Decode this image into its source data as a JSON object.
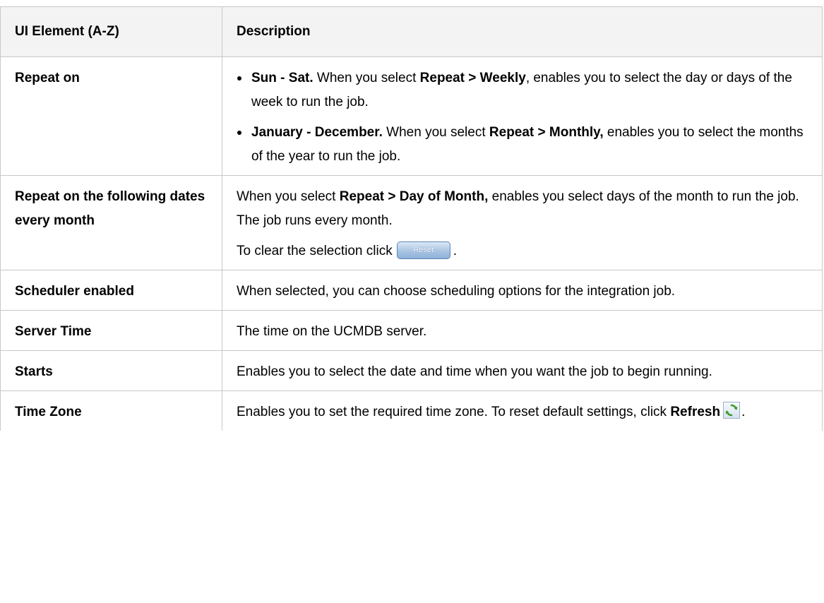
{
  "table": {
    "header": {
      "col1": "UI Element (A-Z)",
      "col2": "Description"
    },
    "rows": [
      {
        "term": "Repeat on",
        "bullets": [
          {
            "bold": "Sun - Sat.",
            "t1": " When you select ",
            "b2": "Repeat > Weekly",
            "t2": ", enables you to select the day or days of the week to run the job."
          },
          {
            "bold": "January - December.",
            "t1": " When you select ",
            "b2": "Repeat > Monthly,",
            "t2": " enables you to select the months of the year to run the job."
          }
        ]
      },
      {
        "term": "Repeat on the following dates every month",
        "p1_t1": "When you select ",
        "p1_b1": "Repeat > Day of Month,",
        "p1_t2": " enables you select days of the month to run the job. The job runs every month.",
        "p2_t1": "To clear the selection click",
        "reset_label": "Reset",
        "p2_t2": "."
      },
      {
        "term": "Scheduler enabled",
        "desc": "When selected, you can choose scheduling options for the integration job."
      },
      {
        "term": "Server Time",
        "desc": "The time on the UCMDB server."
      },
      {
        "term": "Starts",
        "desc": "Enables you to select the date and time when you want the job to begin running."
      },
      {
        "term": "Time Zone",
        "t1": "Enables you to set the required time zone. To reset default settings, click ",
        "b1": "Refresh",
        "t2": ".",
        "icon": "refresh-icon"
      }
    ]
  },
  "colors": {
    "border": "#c8c8c8",
    "header_bg": "#f3f3f3",
    "button_blue": "#8fb1d9",
    "refresh_green": "#3c9a2c"
  }
}
